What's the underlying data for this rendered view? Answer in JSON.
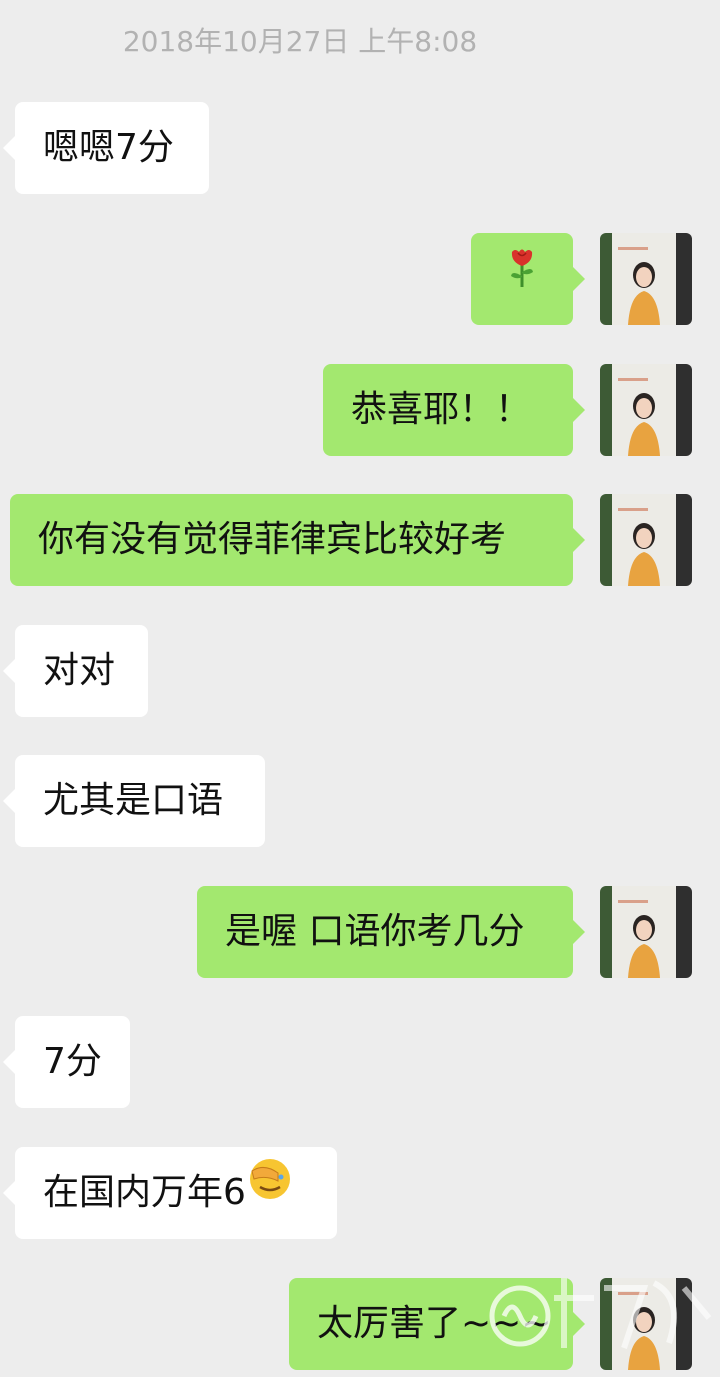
{
  "chat": {
    "timestamp": "2018年10月27日 上午8:08",
    "messages": [
      {
        "side": "in",
        "text": "嗯嗯7分"
      },
      {
        "side": "out",
        "emoji": "rose-emoji"
      },
      {
        "side": "out",
        "text": "恭喜耶！！"
      },
      {
        "side": "out",
        "text": "你有没有觉得菲律宾比较好考"
      },
      {
        "side": "in",
        "text": "对对"
      },
      {
        "side": "in",
        "text": "尤其是口语"
      },
      {
        "side": "out",
        "text": "是喔 口语你考几分"
      },
      {
        "side": "in",
        "text": "7分"
      },
      {
        "side": "in",
        "text": "在国内万年6",
        "emoji": "facepalm-emoji"
      },
      {
        "side": "out",
        "text": "太厉害了~~~"
      }
    ]
  },
  "colors": {
    "background": "#ededed",
    "incoming_bubble": "#ffffff",
    "outgoing_bubble": "#a3e86f",
    "timestamp_text": "#b2b2b2"
  },
  "icons": {
    "avatar": "user-avatar-photo",
    "watermark": "site-watermark-logo"
  }
}
